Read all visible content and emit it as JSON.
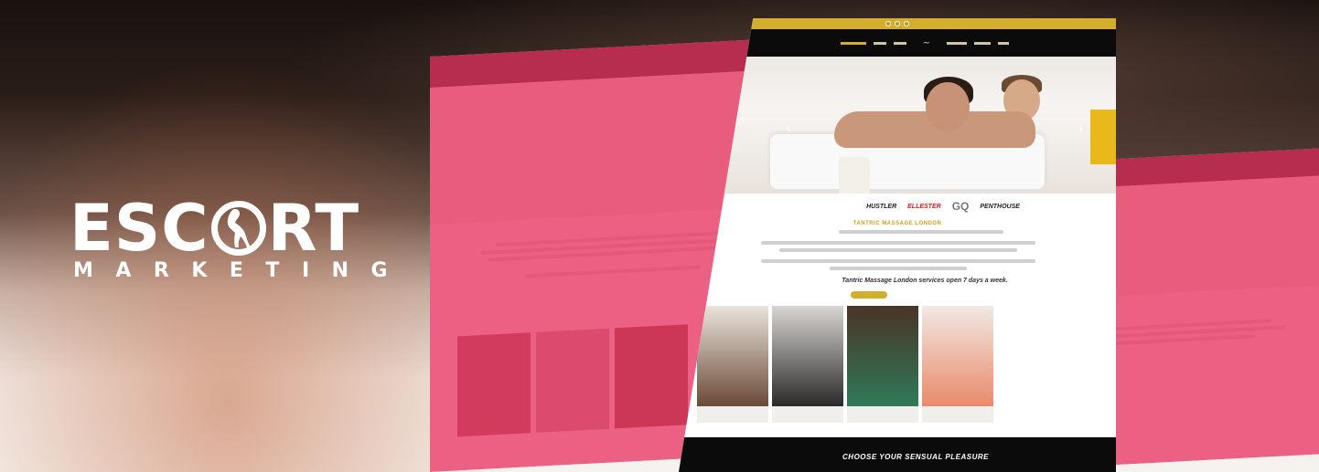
{
  "logo": {
    "word_prefix": "ESC",
    "word_suffix": "RT",
    "subtitle": "MARKETING"
  },
  "main_page": {
    "hero_prev_arrow": "‹",
    "hero_next_arrow": "›",
    "brands": [
      "HUSTLER",
      "ELLESTER",
      "GQ",
      "PENTHOUSE"
    ],
    "section_title": "TANTRIC MASSAGE LONDON",
    "headline": "Tantric Massage London services open 7 days a week.",
    "footer_heading": "CHOOSE YOUR SENSUAL PLEASURE"
  },
  "colors": {
    "gold": "#d4ae2e",
    "pink_overlay": "#e83764",
    "header_black": "#0b0b0b"
  }
}
